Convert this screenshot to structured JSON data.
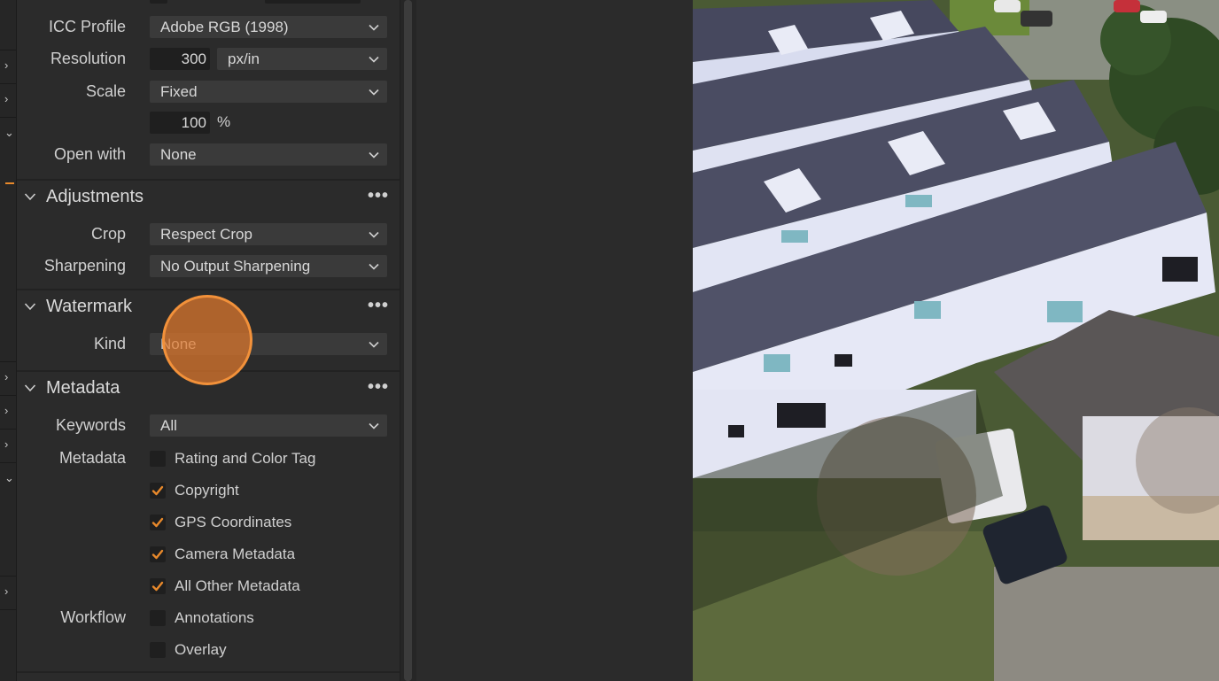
{
  "export": {
    "icc_profile": {
      "label": "ICC Profile",
      "value": "Adobe RGB (1998)"
    },
    "resolution": {
      "label": "Resolution",
      "value": "300",
      "unit": "px/in"
    },
    "scale": {
      "label": "Scale",
      "value": "Fixed",
      "percent": "100",
      "percent_unit": "%"
    },
    "open_with": {
      "label": "Open with",
      "value": "None"
    }
  },
  "adjustments": {
    "title": "Adjustments",
    "crop": {
      "label": "Crop",
      "value": "Respect Crop"
    },
    "sharpening": {
      "label": "Sharpening",
      "value": "No Output Sharpening"
    }
  },
  "watermark": {
    "title": "Watermark",
    "kind": {
      "label": "Kind",
      "value": "None"
    }
  },
  "metadata": {
    "title": "Metadata",
    "keywords": {
      "label": "Keywords",
      "value": "All"
    },
    "metadata_label": "Metadata",
    "items": [
      {
        "label": "Rating and Color Tag",
        "checked": false
      },
      {
        "label": "Copyright",
        "checked": true
      },
      {
        "label": "GPS Coordinates",
        "checked": true
      },
      {
        "label": "Camera Metadata",
        "checked": true
      },
      {
        "label": "All Other Metadata",
        "checked": true
      }
    ],
    "workflow_label": "Workflow",
    "workflow_items": [
      {
        "label": "Annotations",
        "checked": false
      },
      {
        "label": "Overlay",
        "checked": false
      }
    ]
  },
  "more_icon": "more-horizontal-icon",
  "colors": {
    "accent": "#e8892b",
    "panel_bg": "#2b2b2b",
    "field_bg": "#3a3a3a"
  }
}
